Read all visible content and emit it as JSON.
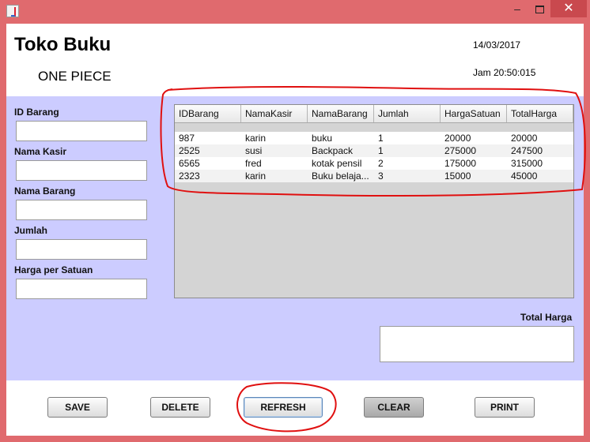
{
  "window": {
    "buttons": {
      "minimize": "–",
      "close": "✕"
    }
  },
  "header": {
    "title": "Toko Buku",
    "subtitle": "ONE PIECE",
    "date": "14/03/2017",
    "time": "Jam 20:50:015"
  },
  "form": {
    "fields": [
      {
        "label": "ID Barang",
        "value": ""
      },
      {
        "label": "Nama Kasir",
        "value": ""
      },
      {
        "label": "Nama Barang",
        "value": ""
      },
      {
        "label": "Jumlah",
        "value": ""
      },
      {
        "label": "Harga per Satuan",
        "value": ""
      }
    ]
  },
  "table": {
    "columns": [
      "IDBarang",
      "NamaKasir",
      "NamaBarang",
      "Jumlah",
      "HargaSatuan",
      "TotalHarga"
    ],
    "rows": [
      [
        "987",
        "karin",
        "buku",
        "1",
        "20000",
        "20000"
      ],
      [
        "2525",
        "susi",
        "Backpack",
        "1",
        "275000",
        "247500"
      ],
      [
        "6565",
        "fred",
        "kotak pensil",
        "2",
        "175000",
        "315000"
      ],
      [
        "2323",
        "karin",
        "Buku belaja...",
        "3",
        "15000",
        "45000"
      ]
    ]
  },
  "total": {
    "label": "Total Harga",
    "value": ""
  },
  "buttons": {
    "save": "SAVE",
    "delete": "DELETE",
    "refresh": "REFRESH",
    "clear": "CLEAR",
    "print": "PRINT"
  },
  "colors": {
    "titlebar": "#e06a6e",
    "form_panel": "#ccccff",
    "annotation": "#e01010"
  },
  "icons": {
    "app": "java-cup-icon",
    "minimize": "minimize-icon",
    "maximize": "maximize-icon",
    "close": "close-icon"
  }
}
